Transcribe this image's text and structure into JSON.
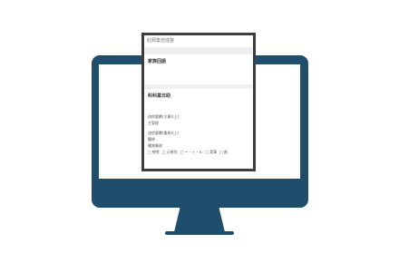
{
  "theme": {
    "monitor_color": "#1f4e6c"
  },
  "popup": {
    "header": "紅師業自成整",
    "section1_title": "家族回語",
    "section2_title": "科科業日助",
    "field1_label": "這他要劃(主業)(上)",
    "field1_value": "主管理",
    "field2_label": "這他要劃(重修)(上)",
    "field2_value1": "權修",
    "field2_value2": "權謝業務",
    "options": [
      "視覚",
      "示視別",
      "ー・ト・ル",
      "実事",
      "創"
    ]
  }
}
